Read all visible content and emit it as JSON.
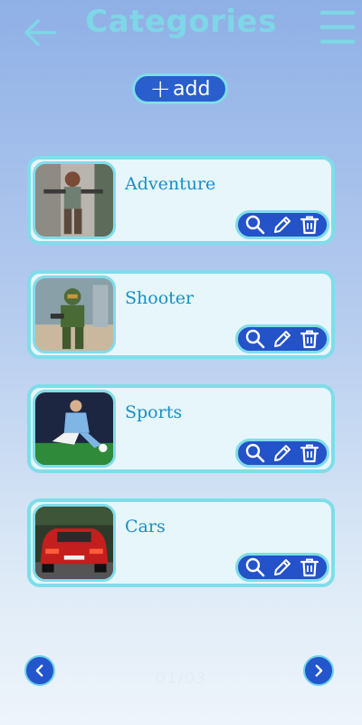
{
  "header": {
    "title": "Categories",
    "back_icon": "arrow-left-icon",
    "menu_icon": "hamburger-menu-icon"
  },
  "add_button": {
    "label": "add",
    "icon": "plus-icon"
  },
  "categories": [
    {
      "name": "Adventure",
      "image": "adventure-character-image"
    },
    {
      "name": "Shooter",
      "image": "shooter-soldier-image"
    },
    {
      "name": "Sports",
      "image": "football-player-image"
    },
    {
      "name": "Cars",
      "image": "red-car-image"
    }
  ],
  "actions": [
    "search-icon",
    "pencil-icon",
    "trash-icon"
  ],
  "pagination": {
    "text": "01/03",
    "prev_icon": "chevron-left-icon",
    "next_icon": "chevron-right-icon"
  },
  "colors": {
    "accent": "#7fdde9",
    "button_blue": "#2452c9",
    "title": "#7ed6e6",
    "label": "#1a8fc6"
  }
}
